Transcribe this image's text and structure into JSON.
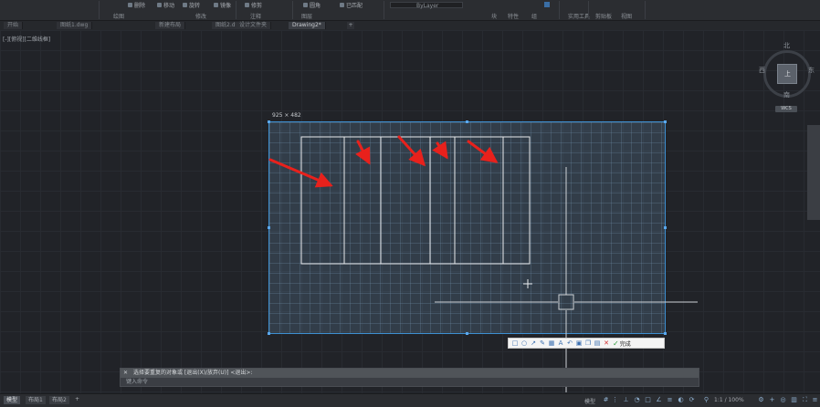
{
  "ribbon": {
    "items": [
      "删除",
      "移动",
      "旋转",
      "镜像",
      "修剪",
      "圆角",
      "阵列",
      "特性",
      "图层",
      "匹配",
      "创建",
      "编辑",
      "插入",
      "组",
      "测量",
      "粘贴",
      "已匹配",
      "插入"
    ],
    "groups": [
      "绘图",
      "修改",
      "注释",
      "图层",
      "块",
      "特性",
      "组",
      "实用工具",
      "剪贴板",
      "视图"
    ],
    "layer_value": "ByLayer",
    "layer_hint": "已匹配"
  },
  "tabs": [
    "开始",
    "图纸1.dwg",
    "新建布局",
    "图纸2.dwg",
    "设计文件夹",
    "Drawing2*"
  ],
  "viewport": {
    "label": "[-][俯视][二维线框]"
  },
  "viewcube": {
    "north": "北",
    "south": "南",
    "east": "东",
    "west": "西",
    "cube_face": "上",
    "wcs": "WCS"
  },
  "snip": {
    "size_label": "925 × 482"
  },
  "snip_toolbar": {
    "finish_label": "完成"
  },
  "command": {
    "history": "选择要重复的对象或 [退出(X)/放弃(U)] <退出>:",
    "prompt": "键入命令"
  },
  "status": {
    "tabs": [
      "模型",
      "布局1",
      "布局2"
    ],
    "model_label": "模型",
    "scale": "1:1 / 100%"
  },
  "colors": {
    "accent": "#3d8fd1",
    "arrow": "#e8211c",
    "background": "#212328"
  }
}
